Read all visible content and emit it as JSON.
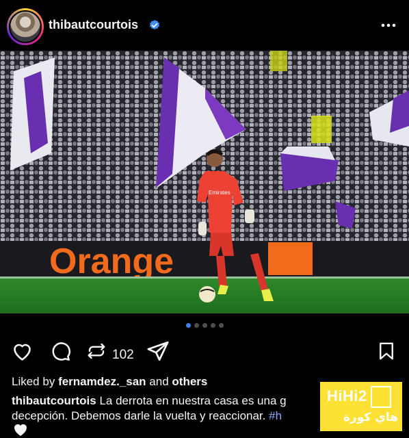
{
  "post": {
    "username": "thibautcourtois",
    "repost_count": "102",
    "liked_by_prefix": "Liked by",
    "liked_by_user": "fernamdez._san",
    "liked_by_and": "and",
    "liked_by_others": "others",
    "caption_user": "thibautcourtois",
    "caption_text_1": "La derrota en nuestra casa es una g",
    "caption_text_2": "decepción. Debemos darle la vuelta y reaccionar.",
    "caption_hashtag": "#h"
  },
  "photo": {
    "ad_board_text": "Orange",
    "shirt_text": "Emirates"
  },
  "carousel": {
    "total": 5,
    "active_index": 0
  },
  "watermark": {
    "brand": "HiHi2",
    "arabic": "هاي كورة"
  },
  "icons": [
    "verified-badge-icon",
    "more-options-icon",
    "heart-icon",
    "comment-icon",
    "repost-icon",
    "share-icon",
    "bookmark-icon"
  ],
  "colors": {
    "background": "#000000",
    "verified": "#3f8ef7",
    "active_dot": "#3f7fe8",
    "hashtag": "#8ea7ff",
    "watermark": "#fde235",
    "ad_orange": "#f26b1d"
  }
}
